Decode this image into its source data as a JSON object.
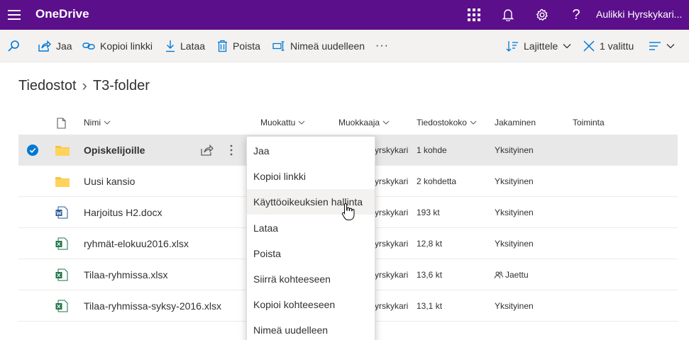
{
  "app": {
    "title": "OneDrive",
    "user": "Aulikki Hyrskykari..."
  },
  "toolbar": {
    "share": "Jaa",
    "copy_link": "Kopioi linkki",
    "download": "Lataa",
    "delete": "Poista",
    "rename": "Nimeä uudelleen",
    "more": "···",
    "sort": "Lajittele",
    "selected": "1 valittu"
  },
  "breadcrumb": {
    "root": "Tiedostot",
    "separator": "›",
    "current": "T3-folder"
  },
  "columns": {
    "name": "Nimi",
    "modified": "Muokattu",
    "modified_by": "Muokkaaja",
    "size": "Tiedostokoko",
    "sharing": "Jakaminen",
    "activity": "Toiminta"
  },
  "rows": [
    {
      "name": "Opiskelijoille",
      "type": "folder",
      "modified_by": "yrskykari",
      "size": "1 kohde",
      "sharing": "Yksityinen",
      "selected": true
    },
    {
      "name": "Uusi kansio",
      "type": "folder",
      "modified_by": "yrskykari",
      "size": "2 kohdetta",
      "sharing": "Yksityinen",
      "selected": false
    },
    {
      "name": "Harjoitus H2.docx",
      "type": "word",
      "modified_by": "yrskykari",
      "size": "193 kt",
      "sharing": "Yksityinen",
      "selected": false
    },
    {
      "name": "ryhmät-elokuu2016.xlsx",
      "type": "excel",
      "modified_by": "yrskykari",
      "size": "12,8 kt",
      "sharing": "Yksityinen",
      "selected": false
    },
    {
      "name": "Tilaa-ryhmissa.xlsx",
      "type": "excel",
      "modified_by": "yrskykari",
      "size": "13,6 kt",
      "sharing": "Jaettu",
      "selected": false
    },
    {
      "name": "Tilaa-ryhmissa-syksy-2016.xlsx",
      "type": "excel",
      "modified_by": "yrskykari",
      "size": "13,1 kt",
      "sharing": "Yksityinen",
      "selected": false
    }
  ],
  "context_menu": {
    "items": [
      "Jaa",
      "Kopioi linkki",
      "Käyttöoikeuksien hallinta",
      "Lataa",
      "Poista",
      "Siirrä kohteeseen",
      "Kopioi kohteeseen",
      "Nimeä uudelleen"
    ],
    "hovered": "Käyttöoikeuksien hallinta"
  },
  "icons": {
    "waffle": "hamburger-menu-icon",
    "apps": "app-launcher-icon",
    "notifications": "bell-icon",
    "settings": "gear-icon",
    "help": "question-mark-icon",
    "folder_color": "#f6c344",
    "word_color": "#2b579a",
    "excel_color": "#217346",
    "check_color": "#0078d4"
  },
  "colors": {
    "suite_bar": "#5c0f8b",
    "accent": "#0078d4"
  }
}
